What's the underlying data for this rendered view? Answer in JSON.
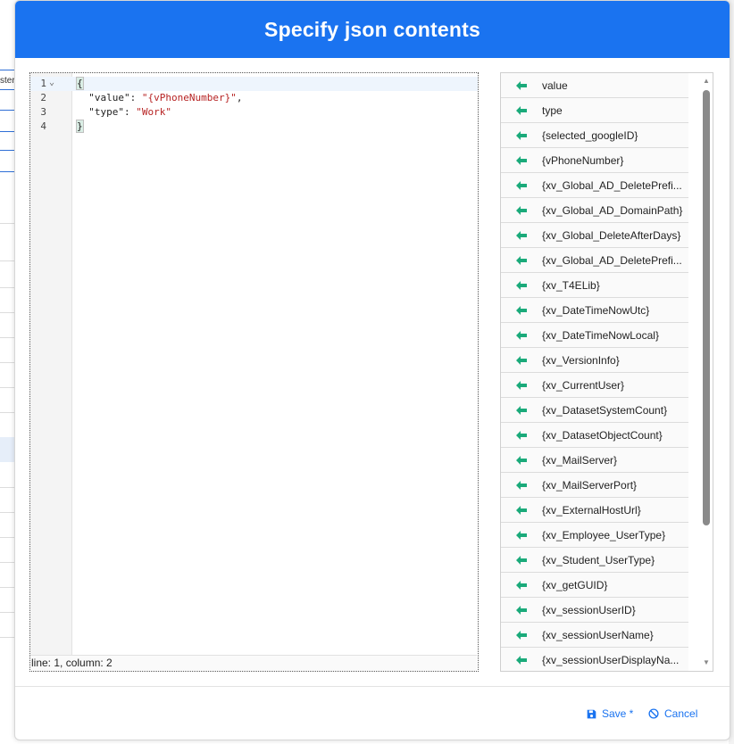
{
  "background": {
    "truncated_text": "ster"
  },
  "modal": {
    "title": "Specify json contents"
  },
  "editor": {
    "lines": [
      {
        "num": "1",
        "fold": "⌄",
        "tokens": [
          {
            "t": "{",
            "cls": "brace"
          }
        ]
      },
      {
        "num": "2",
        "tokens": [
          {
            "t": "  \"value\": ",
            "cls": ""
          },
          {
            "t": "\"{vPhoneNumber}\"",
            "cls": "str"
          },
          {
            "t": ",",
            "cls": ""
          }
        ]
      },
      {
        "num": "3",
        "tokens": [
          {
            "t": "  \"type\": ",
            "cls": ""
          },
          {
            "t": "\"Work\"",
            "cls": "str"
          }
        ]
      },
      {
        "num": "4",
        "tokens": [
          {
            "t": "}",
            "cls": "brace"
          }
        ]
      }
    ],
    "status": "line: 1, column: 2"
  },
  "variables": {
    "arrow_icon": "arrow-left-icon",
    "accent_color": "#1aaa7a",
    "items": [
      "value",
      "type",
      "{selected_googleID}",
      "{vPhoneNumber}",
      "{xv_Global_AD_DeletePrefi...",
      "{xv_Global_AD_DomainPath}",
      "{xv_Global_DeleteAfterDays}",
      "{xv_Global_AD_DeletePrefi...",
      "{xv_T4ELib}",
      "{xv_DateTimeNowUtc}",
      "{xv_DateTimeNowLocal}",
      "{xv_VersionInfo}",
      "{xv_CurrentUser}",
      "{xv_DatasetSystemCount}",
      "{xv_DatasetObjectCount}",
      "{xv_MailServer}",
      "{xv_MailServerPort}",
      "{xv_ExternalHostUrl}",
      "{xv_Employee_UserType}",
      "{xv_Student_UserType}",
      "{xv_getGUID}",
      "{xv_sessionUserID}",
      "{xv_sessionUserName}",
      "{xv_sessionUserDisplayNa..."
    ]
  },
  "footer": {
    "save_label": "Save *",
    "cancel_label": "Cancel",
    "accent_color": "#1a73f0"
  }
}
